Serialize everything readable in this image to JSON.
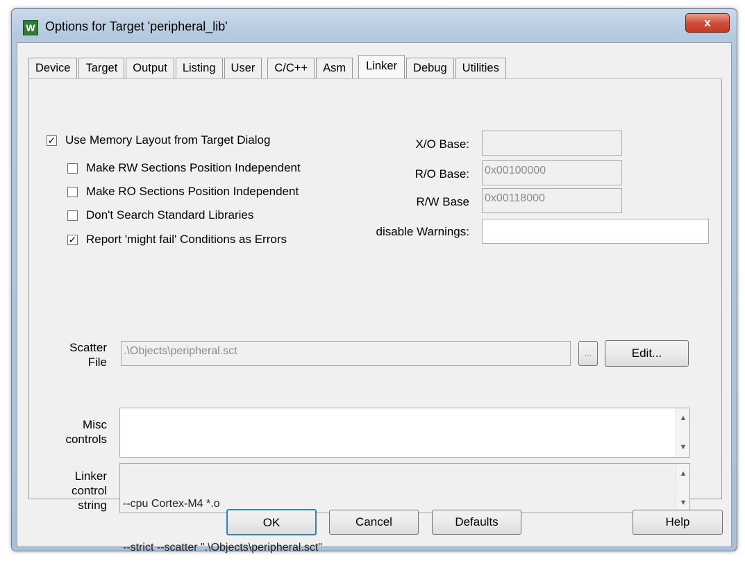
{
  "window": {
    "title": "Options for Target 'peripheral_lib'",
    "app_icon_glyph": "W",
    "close_glyph": "x"
  },
  "tabs": [
    {
      "label": "Device"
    },
    {
      "label": "Target"
    },
    {
      "label": "Output"
    },
    {
      "label": "Listing"
    },
    {
      "label": "User"
    },
    {
      "label": "C/C++"
    },
    {
      "label": "Asm"
    },
    {
      "label": "Linker",
      "active": true
    },
    {
      "label": "Debug"
    },
    {
      "label": "Utilities"
    }
  ],
  "linker": {
    "use_memory_layout": {
      "label": "Use Memory Layout from Target Dialog",
      "checked": true
    },
    "rw_independent": {
      "label": "Make RW Sections Position Independent",
      "checked": false
    },
    "ro_independent": {
      "label": "Make RO Sections Position Independent",
      "checked": false
    },
    "no_std_libs": {
      "label": "Don't Search Standard Libraries",
      "checked": false
    },
    "might_fail_errors": {
      "label": "Report 'might fail' Conditions as Errors",
      "checked": true
    },
    "xo_base": {
      "label": "X/O Base:",
      "value": ""
    },
    "ro_base": {
      "label": "R/O Base:",
      "value": "0x00100000"
    },
    "rw_base": {
      "label": "R/W Base",
      "value": "0x00118000"
    },
    "disable_warnings": {
      "label": "disable Warnings:",
      "value": ""
    },
    "scatter": {
      "label_line1": "Scatter",
      "label_line2": "File",
      "value": ".\\Objects\\peripheral.sct",
      "browse_label": "...",
      "edit_label": "Edit..."
    },
    "misc": {
      "label_line1": "Misc",
      "label_line2": "controls",
      "value": ""
    },
    "control_string": {
      "label_line1": "Linker",
      "label_line2": "control",
      "label_line3": "string",
      "line1": "--cpu Cortex-M4 *.o",
      "line2": "--strict --scatter \".\\Objects\\peripheral.sct\""
    },
    "check_glyph": "✓",
    "scroll_up_glyph": "▲",
    "scroll_down_glyph": "▼"
  },
  "buttons": {
    "ok": "OK",
    "cancel": "Cancel",
    "defaults": "Defaults",
    "help": "Help"
  }
}
